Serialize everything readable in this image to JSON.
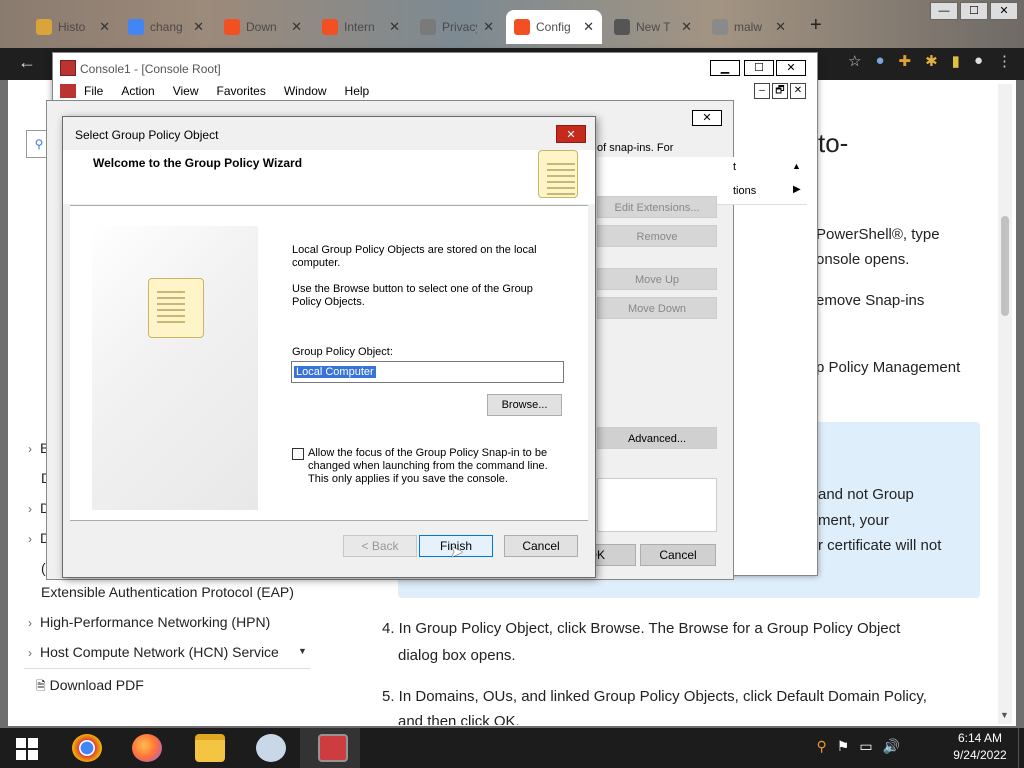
{
  "browser": {
    "tabs": [
      {
        "label": "Histo",
        "fav_color": "#d9a43a"
      },
      {
        "label": "chang",
        "fav_color": "#4285f4"
      },
      {
        "label": "Down",
        "fav_color": "#f25022"
      },
      {
        "label": "Intern",
        "fav_color": "#f25022"
      },
      {
        "label": "Privacy a",
        "fav_color": "#7a7a7a"
      },
      {
        "label": "Config",
        "fav_color": "#f25022"
      },
      {
        "label": "New T",
        "fav_color": "#555555"
      },
      {
        "label": "malw",
        "fav_color": "#8a8a8a"
      }
    ],
    "new_tab": "+",
    "window_controls": [
      "—",
      "☐",
      "✕"
    ]
  },
  "page": {
    "heading_fragment": "to-",
    "right_lines": [
      "PowerShell®, type",
      "onsole opens.",
      "emove Snap-ins",
      "p Policy Management"
    ],
    "note_lines": [
      "and not Group",
      "ment, your",
      "r certificate will not"
    ],
    "step4_a": "4. In ",
    "step4_b": "Group Policy Object",
    "step4_c": ", click ",
    "step4_d": "Browse",
    "step4_e": ". The ",
    "step4_f": "Browse for a Group Policy Object",
    "step4_g": "dialog box opens.",
    "step5_a": "5. In ",
    "step5_b": "Domains, OUs, and linked Group Policy Objects,",
    "step5_c": " click ",
    "step5_d": "Default Domain Policy",
    "step5_e": ",",
    "step5_f": "and then click OK.",
    "left_tree": [
      {
        "label": "B",
        "chev": "›"
      },
      {
        "label": "D",
        "chev": ""
      },
      {
        "label": "D",
        "chev": "›"
      },
      {
        "label": "D",
        "chev": "›"
      },
      {
        "label": "(",
        "chev": ""
      },
      {
        "label": "Extensible Authentication Protocol (EAP)",
        "chev": ""
      },
      {
        "label": "High-Performance Networking (HPN)",
        "chev": "›"
      },
      {
        "label": "Host Compute Network (HCN) Service",
        "chev": "›"
      }
    ],
    "download_pdf": "Download PDF"
  },
  "mmc": {
    "title": "Console1 - [Console Root]",
    "menu": [
      "File",
      "Action",
      "View",
      "Favorites",
      "Window",
      "Help"
    ],
    "ctl": [
      "▁",
      "☐",
      "✕"
    ],
    "sub_ctl": [
      "–",
      "🗗",
      "✕"
    ]
  },
  "snapin": {
    "desc_fragment": "of snap-ins. For",
    "list_items": [
      "t",
      "tions"
    ],
    "buttons": {
      "edit_ext": "Edit Extensions...",
      "remove": "Remove",
      "move_up": "Move Up",
      "move_down": "Move Down",
      "advanced": "Advanced...",
      "ok": "OK",
      "cancel": "Cancel"
    }
  },
  "wizard": {
    "title": "Select Group Policy Object",
    "header": "Welcome to the Group Policy Wizard",
    "para1": "Local Group Policy Objects are stored on the local computer.",
    "para2": "Use the Browse button to select one of the Group Policy Objects.",
    "gpo_label": "Group Policy Object:",
    "gpo_value": "Local Computer",
    "browse": "Browse...",
    "checkbox_label": "Allow the focus of the Group Policy Snap-in to be changed when launching from the command line.  This only applies if you save the console.",
    "back": "< Back",
    "finish": "Finish",
    "cancel": "Cancel",
    "close": "✕"
  },
  "taskbar": {
    "time": "6:14 AM",
    "date": "9/24/2022"
  }
}
